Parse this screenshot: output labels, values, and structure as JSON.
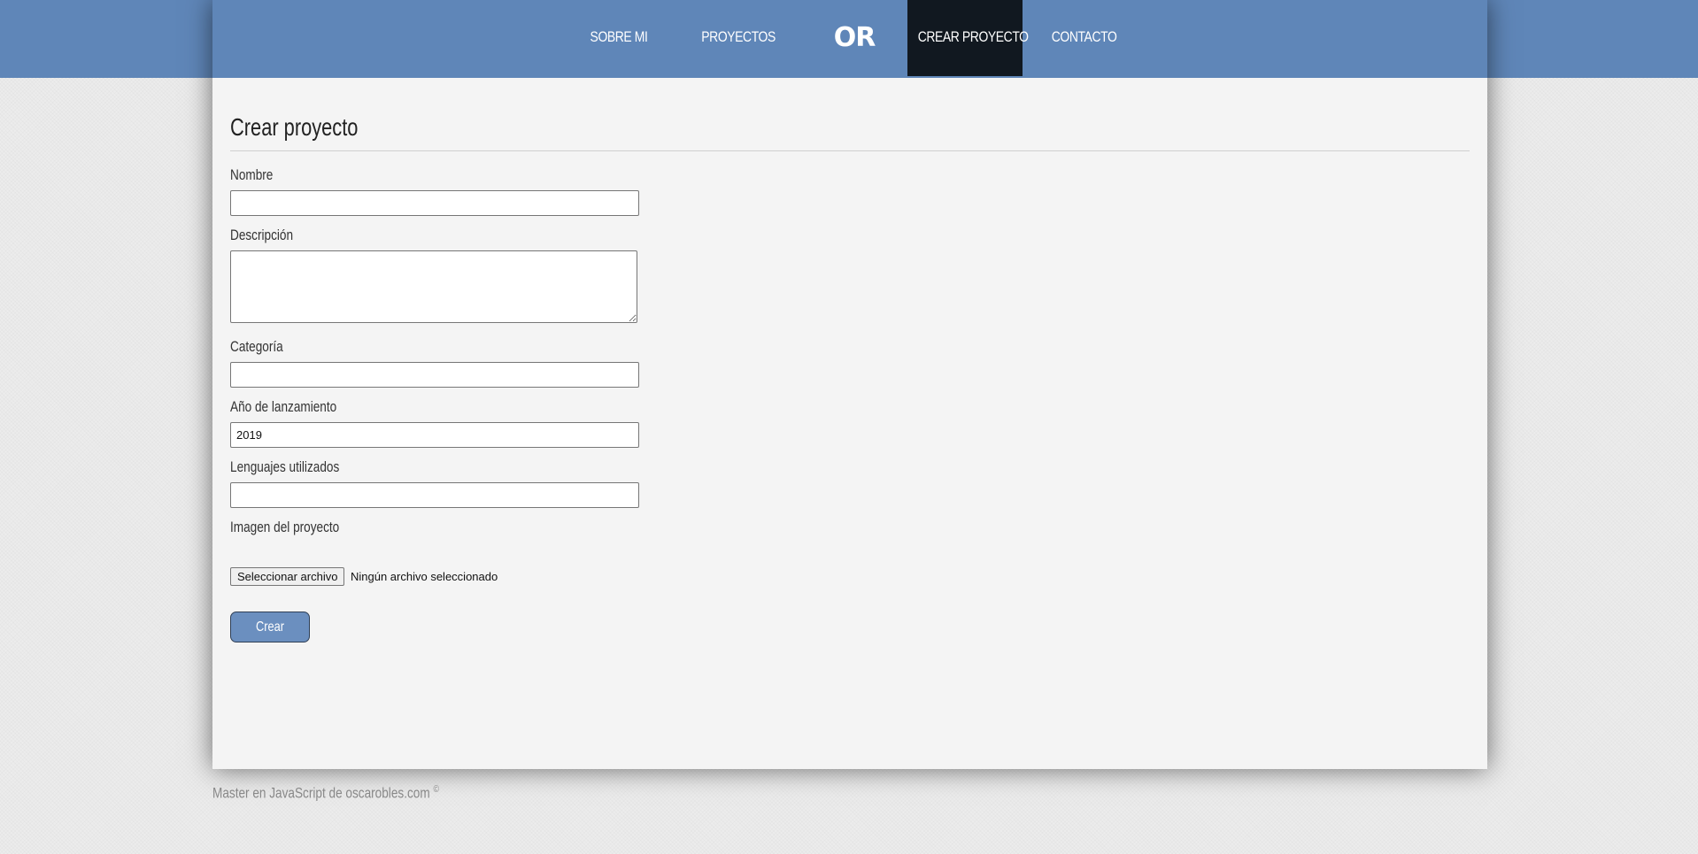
{
  "nav": {
    "items": [
      {
        "label": "SOBRE MI"
      },
      {
        "label": "PROYECTOS"
      },
      {
        "label": "CREAR PROYECTO",
        "active": true
      },
      {
        "label": "CONTACTO"
      }
    ],
    "logo_text": "OR"
  },
  "form": {
    "title": "Crear proyecto",
    "fields": {
      "nombre": {
        "label": "Nombre",
        "value": ""
      },
      "descripcion": {
        "label": "Descripción",
        "value": ""
      },
      "categoria": {
        "label": "Categoría",
        "value": ""
      },
      "anio": {
        "label": "Año de lanzamiento",
        "value": "2019"
      },
      "lenguajes": {
        "label": "Lenguajes utilizados",
        "value": ""
      },
      "imagen": {
        "label": "Imagen del proyecto",
        "button_label": "Seleccionar archivo",
        "status": "Ningún archivo seleccionado"
      }
    },
    "submit_label": "Crear"
  },
  "footer": {
    "text": "Master en JavaScript de oscarobles.com",
    "symbol": "©"
  },
  "colors": {
    "nav_background": "#5f86b8",
    "nav_active_background": "#111820",
    "button_background": "#6b8fbf",
    "page_background": "#f4f4f4"
  }
}
